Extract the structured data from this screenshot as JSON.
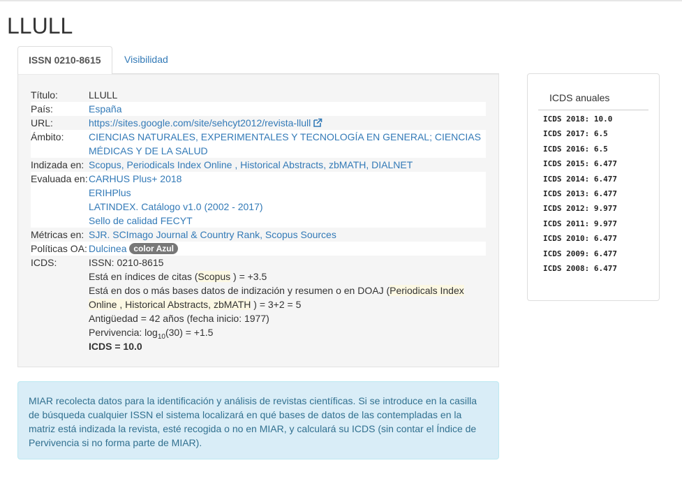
{
  "page_title": "LLULL",
  "tabs": [
    {
      "label": "ISSN 0210-8615"
    },
    {
      "label": "Visibilidad"
    }
  ],
  "details": {
    "titulo": {
      "label": "Título:",
      "value": "LLULL"
    },
    "pais": {
      "label": "País:",
      "value": "España"
    },
    "url": {
      "label": "URL:",
      "value": "https://sites.google.com/site/sehcyt2012/revista-llull"
    },
    "ambito": {
      "label": "Ámbito:",
      "line1": "CIENCIAS NATURALES, EXPERIMENTALES Y TECNOLOGÍA EN GENERAL; CIENCIAS",
      "line2": "MÉDICAS Y DE LA SALUD"
    },
    "indizada": {
      "label": "Indizada en:",
      "items": [
        "Scopus",
        "Periodicals Index Online",
        "Historical Abstracts",
        "zbMATH",
        "DIALNET"
      ],
      "sep1": ", ",
      "sep2": " , ",
      "sep3": ", ",
      "sep4": ", "
    },
    "evaluada": {
      "label": "Evaluada en:",
      "items": [
        "CARHUS Plus+ 2018",
        "ERIHPlus",
        "LATINDEX. Catálogo v1.0 (2002 - 2017)",
        "Sello de calidad FECYT"
      ]
    },
    "metricas": {
      "label": "Métricas en:",
      "items": [
        "SJR. SCImago Journal & Country Rank",
        "Scopus Sources"
      ],
      "sep": ", "
    },
    "politicas": {
      "label": "Políticas OA:",
      "value": "Dulcinea",
      "badge": "color Azul"
    },
    "icds": {
      "label": "ICDS:",
      "issn": "ISSN: 0210-8615",
      "citas_pre": "Está en índices de citas (",
      "citas_db": "Scopus",
      "citas_post": ") = +3.5",
      "bases_pre": "Está en dos o más bases datos de indización y resumen o en DOAJ (",
      "bases_db1": "Periodicals Index",
      "bases_db2": "Online , Historical Abstracts, zbMATH",
      "bases_post": ") = 3+2 = 5",
      "antiguedad": "Antigüedad = 42 años (fecha inicio: 1977)",
      "perv_pre": "Pervivencia: log",
      "perv_sub": "10",
      "perv_post": "(30) = +1.5",
      "total": "ICDS = 10.0"
    }
  },
  "sidebar": {
    "title": "ICDS anuales",
    "items": [
      "ICDS 2018: 10.0",
      "ICDS 2017: 6.5",
      "ICDS 2016: 6.5",
      "ICDS 2015: 6.477",
      "ICDS 2014: 6.477",
      "ICDS 2013: 6.477",
      "ICDS 2012: 9.977",
      "ICDS 2011: 9.977",
      "ICDS 2010: 6.477",
      "ICDS 2009: 6.477",
      "ICDS 2008: 6.477"
    ]
  },
  "info": {
    "text": "MIAR recolecta datos para la identificación y análisis de revistas científicas. Si se introduce en la casilla de búsqueda cualquier ISSN el sistema localizará en qué bases de datos de las contempladas en la matriz está indizada la revista, esté recogida o no en MIAR, y calculará su ICDS (sin contar el Índice de Pervivencia si no forma parte de MIAR)."
  },
  "colors": {
    "link": "#337ab7",
    "badge": "#777777",
    "info_bg": "#d9edf7",
    "info_text": "#31708f",
    "highlight": "#fcf8e3"
  },
  "icons": {
    "external_link": "external-link-icon"
  }
}
